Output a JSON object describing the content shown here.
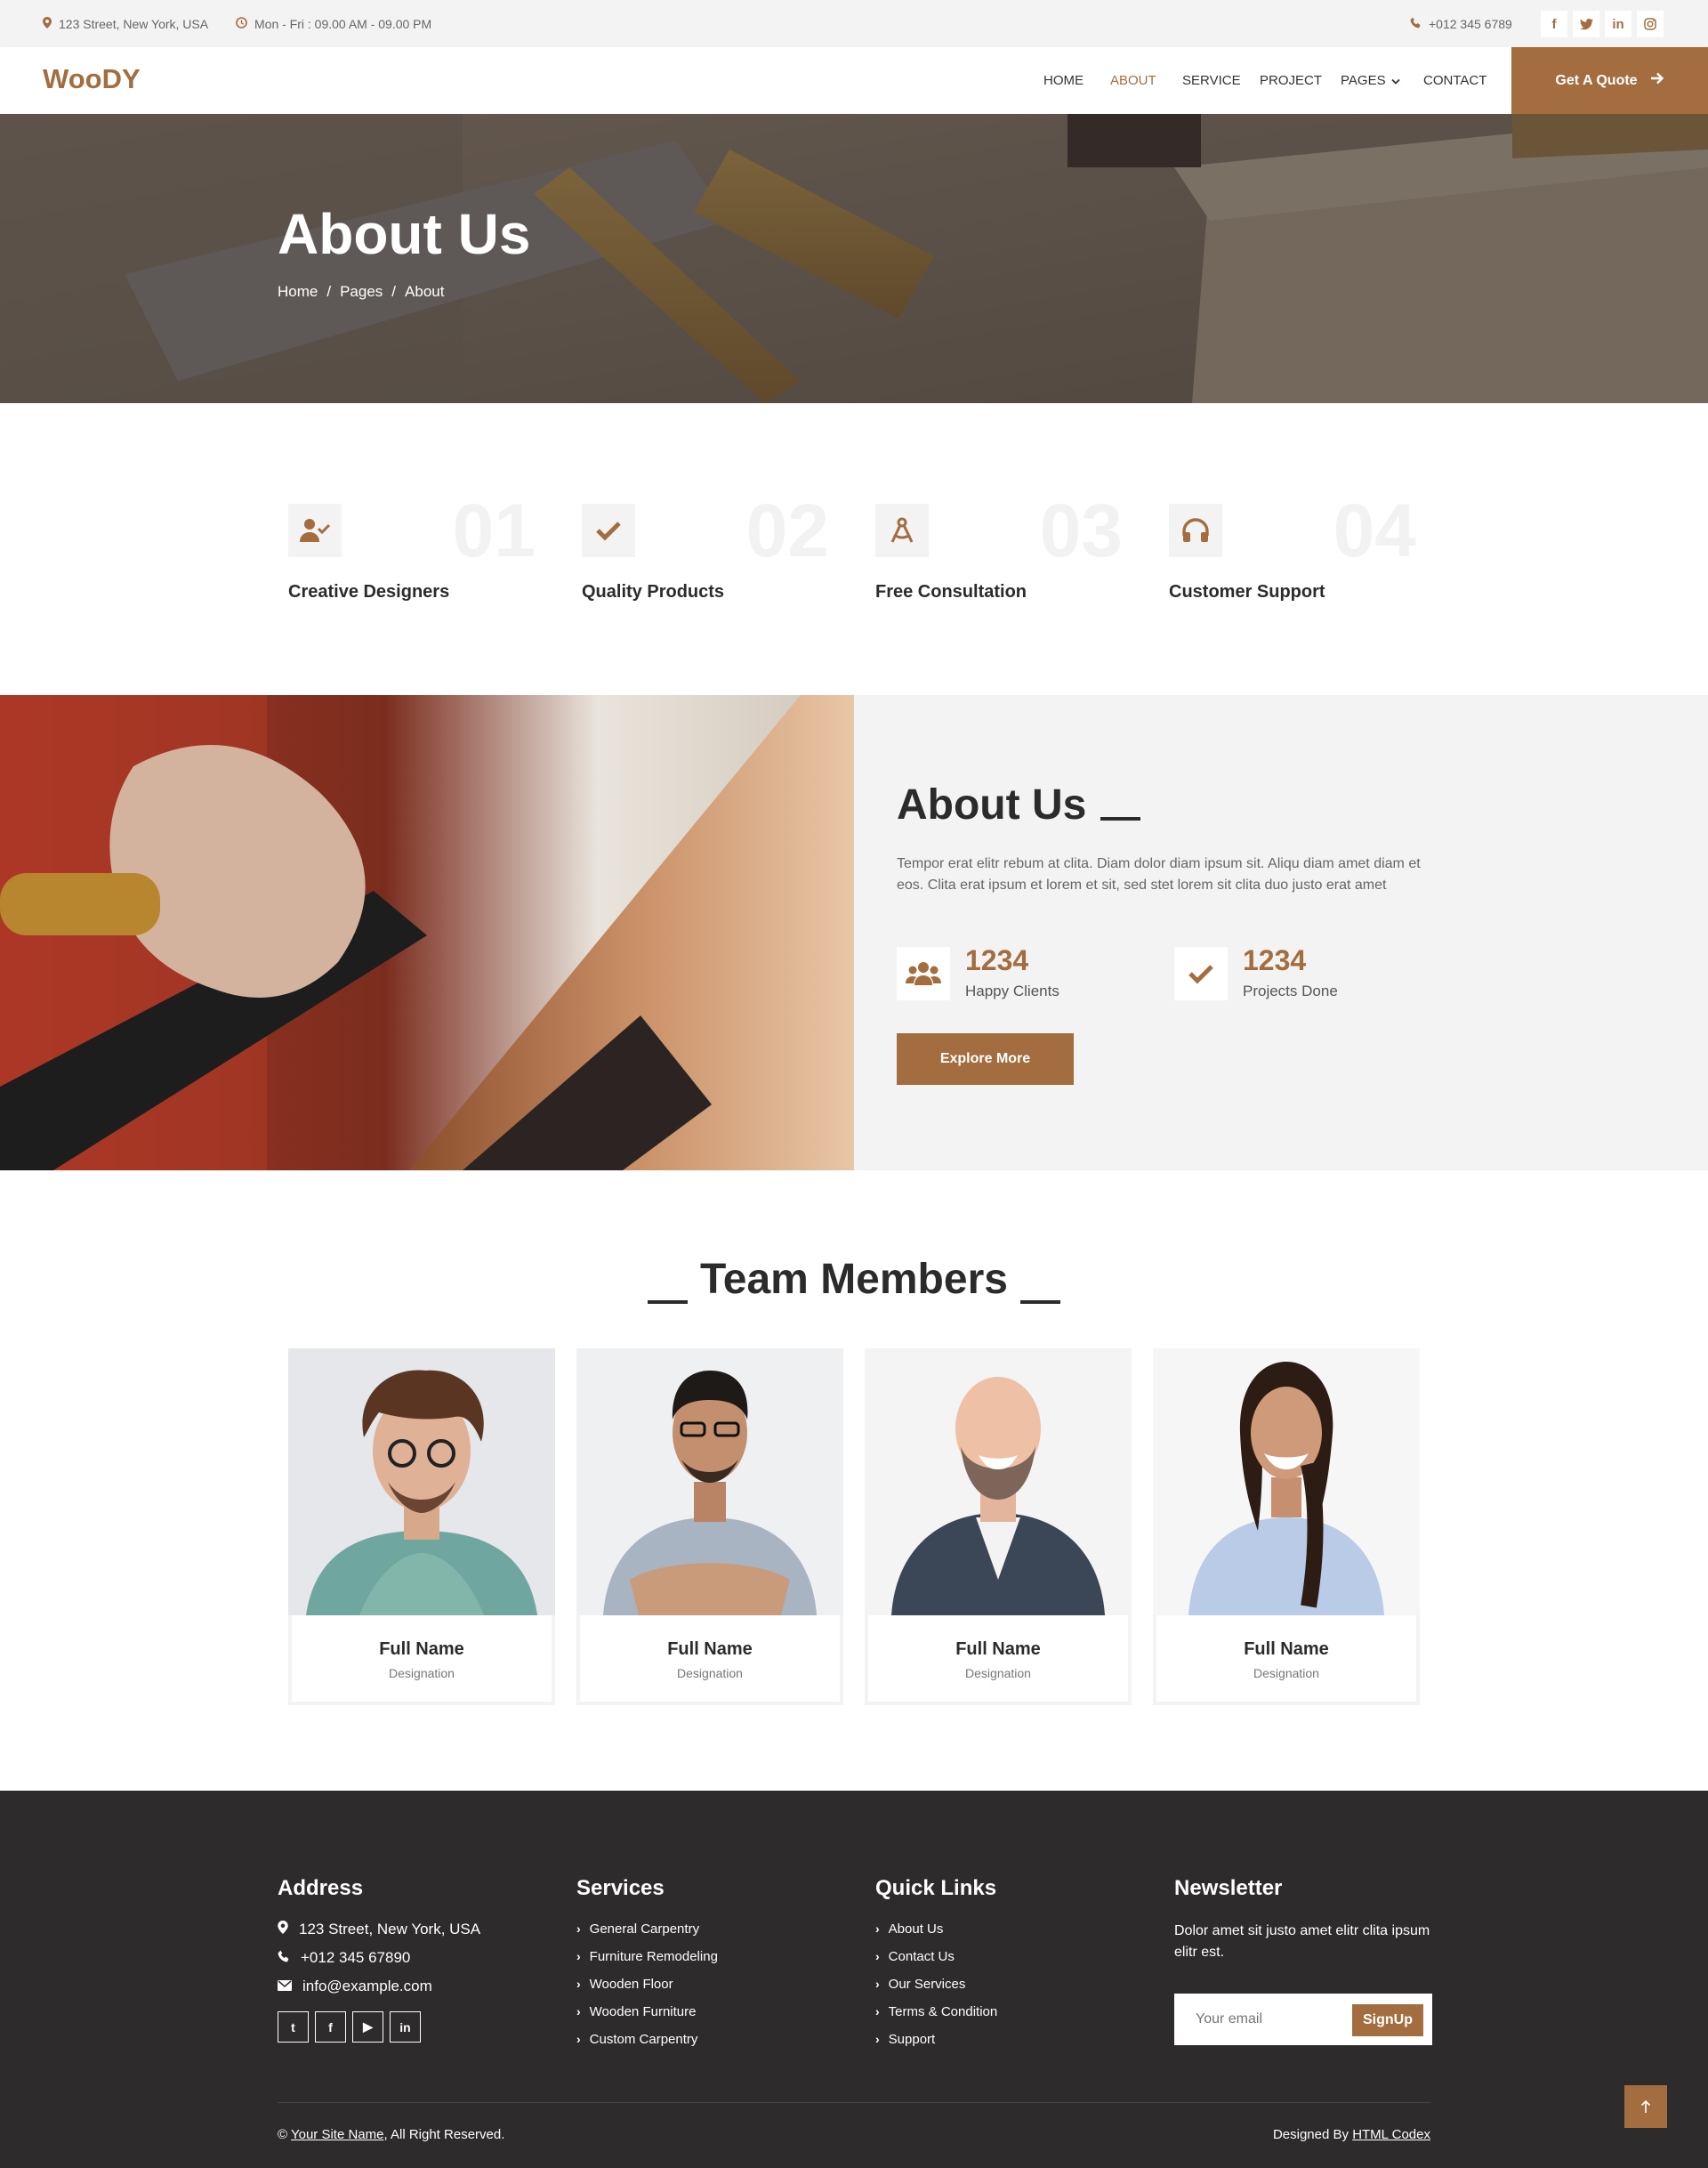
{
  "topbar": {
    "address": "123 Street, New York, USA",
    "hours": "Mon - Fri : 09.00 AM - 09.00 PM",
    "phone": "+012 345 6789",
    "social": [
      "f",
      "t",
      "in",
      "ig"
    ]
  },
  "navbar": {
    "logo": "WooDY",
    "items": [
      "HOME",
      "ABOUT",
      "SERVICE",
      "PROJECT",
      "PAGES",
      "CONTACT"
    ],
    "active": "ABOUT",
    "quote_label": "Get A Quote"
  },
  "hero": {
    "title": "About Us",
    "breadcrumb": [
      "Home",
      "/",
      "Pages",
      "/",
      "About"
    ]
  },
  "features": [
    {
      "num": "01",
      "title": "Creative Designers",
      "icon": "user-check-icon"
    },
    {
      "num": "02",
      "title": "Quality Products",
      "icon": "check-icon"
    },
    {
      "num": "03",
      "title": "Free Consultation",
      "icon": "drafting-compass-icon"
    },
    {
      "num": "04",
      "title": "Customer Support",
      "icon": "headphones-icon"
    }
  ],
  "about": {
    "title": "About Us",
    "text": "Tempor erat elitr rebum at clita. Diam dolor diam ipsum sit. Aliqu diam amet diam et eos. Clita erat ipsum et lorem et sit, sed stet lorem sit clita duo justo erat amet",
    "stats": [
      {
        "num": "1234",
        "label": "Happy Clients",
        "icon": "users-icon"
      },
      {
        "num": "1234",
        "label": "Projects Done",
        "icon": "check-icon"
      }
    ],
    "button": "Explore More"
  },
  "team": {
    "title": "Team Members",
    "members": [
      {
        "name": "Full Name",
        "role": "Designation"
      },
      {
        "name": "Full Name",
        "role": "Designation"
      },
      {
        "name": "Full Name",
        "role": "Designation"
      },
      {
        "name": "Full Name",
        "role": "Designation"
      }
    ]
  },
  "footer": {
    "address_title": "Address",
    "address": "123 Street, New York, USA",
    "phone": "+012 345 67890",
    "email": "info@example.com",
    "social": [
      "t",
      "f",
      "▶",
      "in"
    ],
    "services_title": "Services",
    "services": [
      "General Carpentry",
      "Furniture Remodeling",
      "Wooden Floor",
      "Wooden Furniture",
      "Custom Carpentry"
    ],
    "links_title": "Quick Links",
    "links": [
      "About Us",
      "Contact Us",
      "Our Services",
      "Terms & Condition",
      "Support"
    ],
    "newsletter_title": "Newsletter",
    "newsletter_text": "Dolor amet sit justo amet elitr clita ipsum elitr est.",
    "email_placeholder": "Your email",
    "signup": "SignUp",
    "copyright_symbol": "©",
    "site_name": "Your Site Name",
    "rights": ", All Right Reserved.",
    "designed_by": "Designed By",
    "designer": "HTML Codex"
  },
  "colors": {
    "accent": "#a36d3f",
    "dark": "#2d2b2b",
    "light": "#f3f3f3"
  }
}
